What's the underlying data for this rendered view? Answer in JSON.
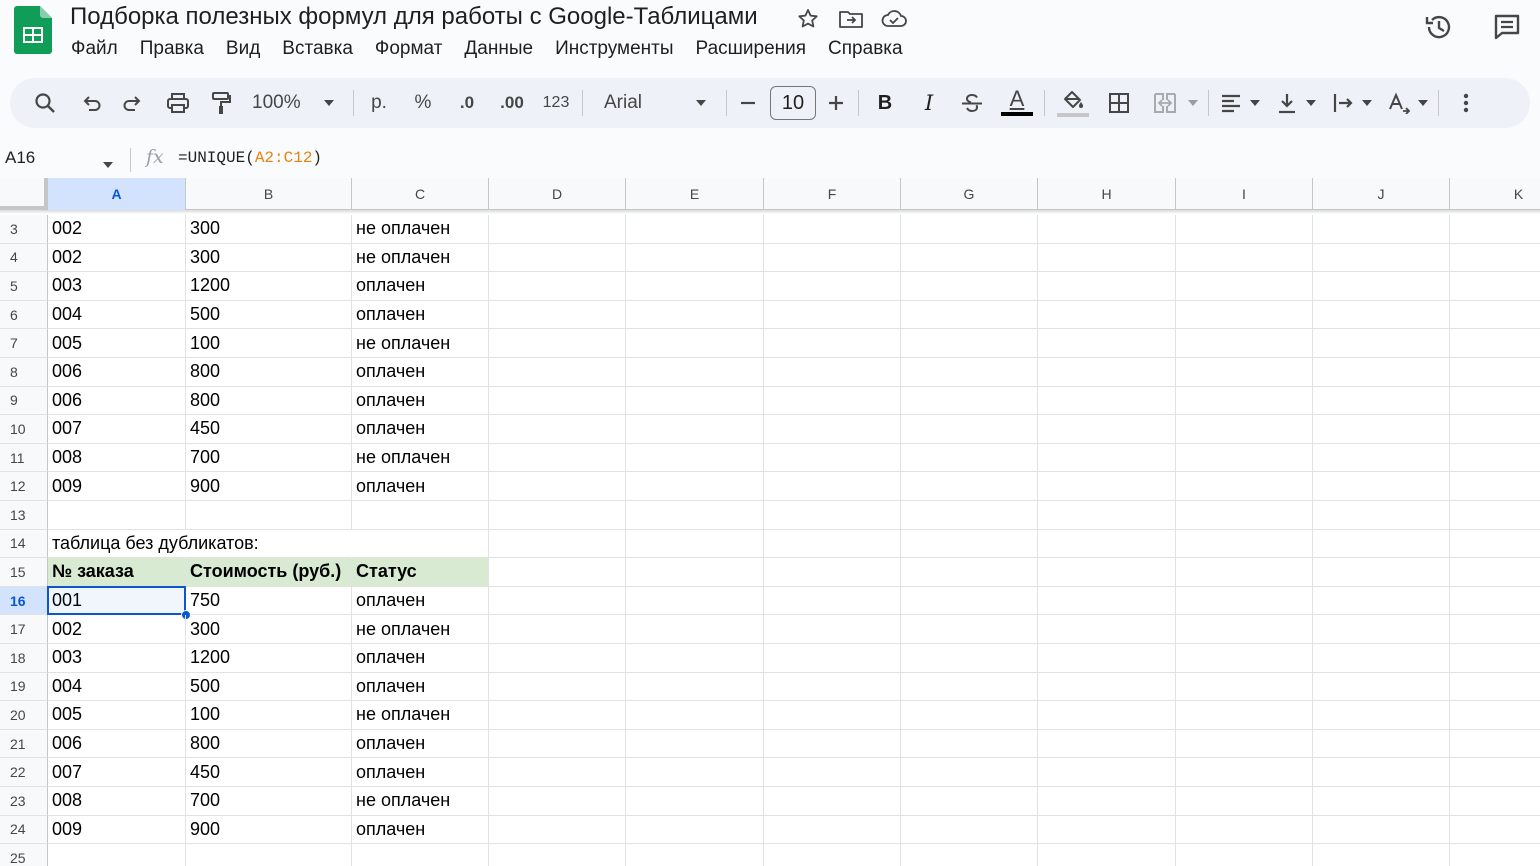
{
  "doc": {
    "title": "Подборка полезных формул для работы с Google-Таблицами"
  },
  "menu": [
    "Файл",
    "Правка",
    "Вид",
    "Вставка",
    "Формат",
    "Данные",
    "Инструменты",
    "Расширения",
    "Справка"
  ],
  "toolbar": {
    "zoom": "100%",
    "currency": "р.",
    "percent": "%",
    "decrease_decimal": ".0",
    "increase_decimal": ".00",
    "number_format": "123",
    "font": "Arial",
    "font_size": "10",
    "bold": "B",
    "italic": "I",
    "text_color_letter": "A",
    "text_color": "#000000",
    "fill_color": "#c7c7c7"
  },
  "formula_bar": {
    "cell_ref": "A16",
    "fx": "fx",
    "formula_prefix": "=UNIQUE(",
    "formula_range": "A2:C12",
    "formula_suffix": ")"
  },
  "columns": [
    "A",
    "B",
    "C",
    "D",
    "E",
    "F",
    "G",
    "H",
    "I",
    "J",
    "K"
  ],
  "active_cell": {
    "col": "A",
    "row": "16"
  },
  "rows": [
    {
      "num": "3",
      "a": "002",
      "b": "300",
      "c": "не оплачен"
    },
    {
      "num": "4",
      "a": "002",
      "b": "300",
      "c": "не оплачен"
    },
    {
      "num": "5",
      "a": "003",
      "b": "1200",
      "c": "оплачен"
    },
    {
      "num": "6",
      "a": "004",
      "b": "500",
      "c": "оплачен"
    },
    {
      "num": "7",
      "a": "005",
      "b": "100",
      "c": "не оплачен"
    },
    {
      "num": "8",
      "a": "006",
      "b": "800",
      "c": "оплачен"
    },
    {
      "num": "9",
      "a": "006",
      "b": "800",
      "c": "оплачен"
    },
    {
      "num": "10",
      "a": "007",
      "b": "450",
      "c": "оплачен"
    },
    {
      "num": "11",
      "a": "008",
      "b": "700",
      "c": "не оплачен"
    },
    {
      "num": "12",
      "a": "009",
      "b": "900",
      "c": "оплачен"
    },
    {
      "num": "13",
      "a": "",
      "b": "",
      "c": ""
    },
    {
      "num": "14",
      "a": "таблица без дубликатов:",
      "b": "",
      "c": "",
      "overflow": true
    },
    {
      "num": "15",
      "a": "№ заказа",
      "b": "Стоимость (руб.)",
      "c": "Статус",
      "header": true
    },
    {
      "num": "16",
      "a": "001",
      "b": "750",
      "c": "оплачен"
    },
    {
      "num": "17",
      "a": "002",
      "b": "300",
      "c": "не оплачен"
    },
    {
      "num": "18",
      "a": "003",
      "b": "1200",
      "c": "оплачен"
    },
    {
      "num": "19",
      "a": "004",
      "b": "500",
      "c": "оплачен"
    },
    {
      "num": "20",
      "a": "005",
      "b": "100",
      "c": "не оплачен"
    },
    {
      "num": "21",
      "a": "006",
      "b": "800",
      "c": "оплачен"
    },
    {
      "num": "22",
      "a": "007",
      "b": "450",
      "c": "оплачен"
    },
    {
      "num": "23",
      "a": "008",
      "b": "700",
      "c": "не оплачен"
    },
    {
      "num": "24",
      "a": "009",
      "b": "900",
      "c": "оплачен"
    },
    {
      "num": "25",
      "a": "",
      "b": "",
      "c": ""
    }
  ],
  "colors": {
    "accent": "#0b57d0",
    "header_fill": "#d9ead3",
    "formula_range": "#e8820c",
    "sheets_green": "#0f9d58"
  }
}
